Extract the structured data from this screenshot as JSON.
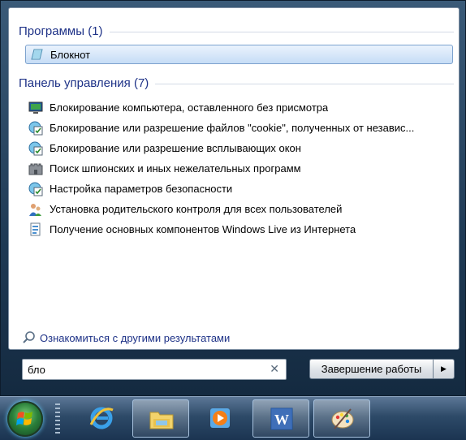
{
  "colors": {
    "header": "#1e3287",
    "selection_border": "#7da2ce",
    "taskbar": "#2d4a68",
    "frame": "#1f3a55"
  },
  "programs": {
    "header": "Программы (1)",
    "items": [
      {
        "label": "Блокнот",
        "icon": "notepad-icon"
      }
    ]
  },
  "control_panel": {
    "header": "Панель управления (7)",
    "items": [
      {
        "label": "Блокирование компьютера, оставленного без присмотра",
        "icon": "monitor-lock-icon"
      },
      {
        "label": "Блокирование или разрешение файлов \"cookie\", полученных от независ...",
        "icon": "internet-options-icon"
      },
      {
        "label": "Блокирование или разрешение всплывающих окон",
        "icon": "internet-options-icon"
      },
      {
        "label": "Поиск шпионских и иных нежелательных программ",
        "icon": "defender-castle-icon"
      },
      {
        "label": "Настройка параметров безопасности",
        "icon": "internet-options-icon"
      },
      {
        "label": "Установка родительского контроля для всех пользователей",
        "icon": "parental-control-icon"
      },
      {
        "label": "Получение основных компонентов Windows Live из Интернета",
        "icon": "windows-live-icon"
      }
    ]
  },
  "more_results": {
    "label": "Ознакомиться с другими результатами",
    "icon": "magnifier-icon"
  },
  "search": {
    "value": "бло",
    "clear_icon": "clear-x-icon"
  },
  "shutdown": {
    "label": "Завершение работы",
    "arrow_icon": "triangle-right-icon"
  },
  "taskbar": {
    "start_icon": "windows-orb-icon",
    "buttons": [
      {
        "icon": "internet-explorer-icon",
        "active": false
      },
      {
        "icon": "explorer-folder-icon",
        "active": true
      },
      {
        "icon": "media-player-icon",
        "active": false
      },
      {
        "icon": "word-icon",
        "active": true
      },
      {
        "icon": "paint-palette-icon",
        "active": true
      }
    ]
  }
}
